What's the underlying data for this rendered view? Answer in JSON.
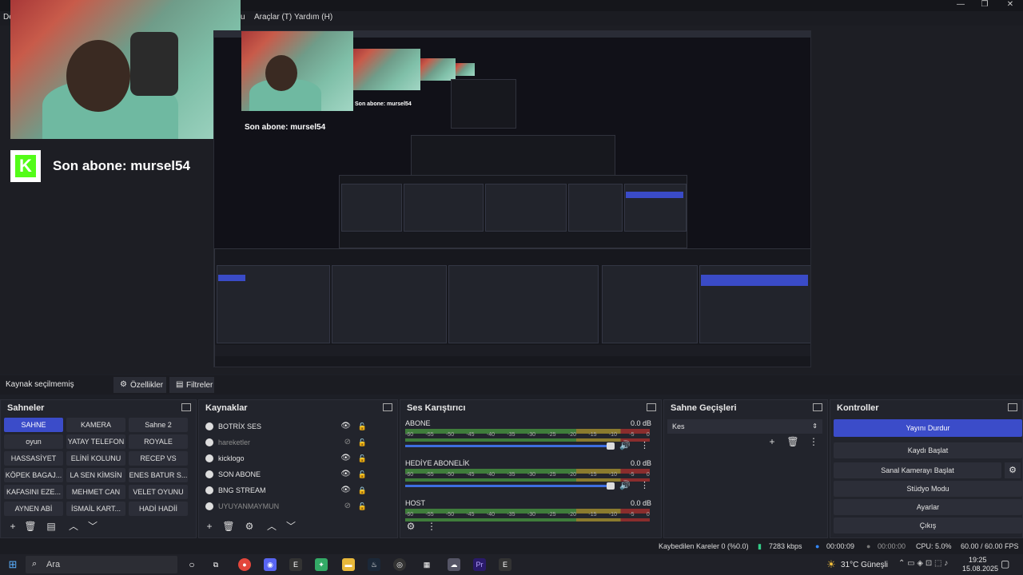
{
  "menu": {
    "items": [
      "Araçlar (T)",
      "Yardım (H)"
    ],
    "left_cut": "De",
    "right_cut": "u"
  },
  "window_controls": [
    "—",
    "❐",
    "✕"
  ],
  "overlay": {
    "subscriber_text": "Son abone: mursel54",
    "logo_letter": "K"
  },
  "nested": {
    "subscriber_text": "Son abone: mursel54",
    "subscriber_text_small": "Son abone: mursel54"
  },
  "source_bar": {
    "status": "Kaynak seçilmemiş",
    "properties": "Özellikler",
    "filters": "Filtreler"
  },
  "scenes": {
    "title": "Sahneler",
    "items": [
      "SAHNE",
      "KAMERA",
      "Sahne 2",
      "oyun",
      "YATAY TELEFON",
      "ROYALE",
      "HASSASİYET",
      "ELİNİ KOLUNU",
      "RECEP VS",
      "KÖPEK BAGAJ...",
      "LA SEN KİMSİN",
      "ENES BATUR S...",
      "KAFASINI EZE...",
      "MEHMET CAN",
      "VELET OYUNU",
      "AYNEN ABİ",
      "İSMAİL KART...",
      "HADİ HADİİ"
    ]
  },
  "sources": {
    "title": "Kaynaklar",
    "items": [
      {
        "label": "BOTRİX SES",
        "muted": false,
        "locked": false
      },
      {
        "label": "hareketler",
        "muted": true,
        "locked": false
      },
      {
        "label": "kicklogo",
        "muted": false,
        "locked": false
      },
      {
        "label": "SON ABONE",
        "muted": false,
        "locked": false
      },
      {
        "label": "BNG STREAM",
        "muted": false,
        "locked": true
      },
      {
        "label": "UYUYANMAYMUN",
        "muted": true,
        "locked": false
      }
    ]
  },
  "mixer": {
    "title": "Ses Karıştırıcı",
    "ticks": [
      "-60",
      "-55",
      "-50",
      "-45",
      "-40",
      "-35",
      "-30",
      "-25",
      "-20",
      "-15",
      "-10",
      "-5",
      "0"
    ],
    "channels": [
      {
        "name": "ABONE",
        "db": "0.0 dB"
      },
      {
        "name": "HEDİYE ABONELİK",
        "db": "0.0 dB"
      },
      {
        "name": "HOST",
        "db": "0.0 dB"
      }
    ]
  },
  "transitions": {
    "title": "Sahne Geçişleri",
    "selected": "Kes"
  },
  "controls": {
    "title": "Kontroller",
    "buttons": [
      "Yayını Durdur",
      "Kaydı Başlat",
      "Sanal Kamerayı Başlat",
      "Stüdyo Modu",
      "Ayarlar",
      "Çıkış"
    ]
  },
  "status": {
    "dropped": "Kaybedilen Kareler 0 (%0.0)",
    "bitrate": "7283 kbps",
    "stream_time": "00:00:09",
    "rec_time": "00:00:00",
    "cpu": "CPU: 5.0%",
    "fps": "60.00 / 60.00 FPS"
  },
  "taskbar": {
    "search": "Ara",
    "weather": "31°C  Güneşli",
    "time": "19:25",
    "date": "15.08.2025"
  },
  "colors": {
    "accent": "#3b4cc9",
    "kick_green": "#53fc18",
    "panel": "#22242c"
  }
}
